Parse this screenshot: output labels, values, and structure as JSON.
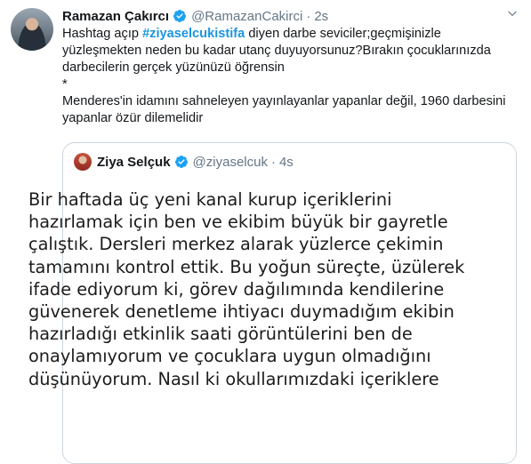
{
  "tweet": {
    "author_name": "Ramazan Çakırcı",
    "handle": "@RamazanCakirci",
    "separator": "·",
    "time": "2s",
    "text_before_hashtag": "Hashtag açıp ",
    "hashtag": "#ziyaselcukistifa",
    "text_after_hashtag": " diyen darbe seviciler;geçmişinizle yüzleşmekten neden bu kadar utanç duyuyorsunuz?Bırakın çocuklarınızda darbecilerin gerçek yüzünüzü öğrensin",
    "asterisk": "*",
    "text_second": "Menderes'in idamını sahneleyen yayınlayanlar yapanlar değil, 1960 darbesini yapanlar özür dilemelidir"
  },
  "quoted_tweet": {
    "author_name": "Ziya Selçuk",
    "handle": "@ziyaselcuk",
    "separator": "·",
    "time": "4s",
    "image_text_lines": [
      "Bir haftada üç yeni kanal kurup içeriklerini",
      "hazırlamak için ben ve ekibim büyük bir gayretle",
      "çalıştık. Dersleri merkez alarak yüzlerce çekimin",
      "tamamını kontrol ettik. Bu yoğun süreçte, üzülerek",
      "ifade ediyorum ki, görev dağılımında kendilerine",
      "güvenerek denetleme ihtiyacı duymadığım ekibin",
      "hazırladığı etkinlik saati görüntülerini ben de",
      "onaylamıyorum ve çocuklara uygun olmadığını",
      "düşünüyorum. Nasıl ki okullarımızdaki içeriklere"
    ]
  },
  "colors": {
    "link": "#1b95e0",
    "verified": "#1da1f2",
    "secondary_text": "#657786",
    "border": "#ccd6dd"
  },
  "icons": {
    "verified": "verified-badge-icon",
    "menu": "chevron-down-icon"
  }
}
